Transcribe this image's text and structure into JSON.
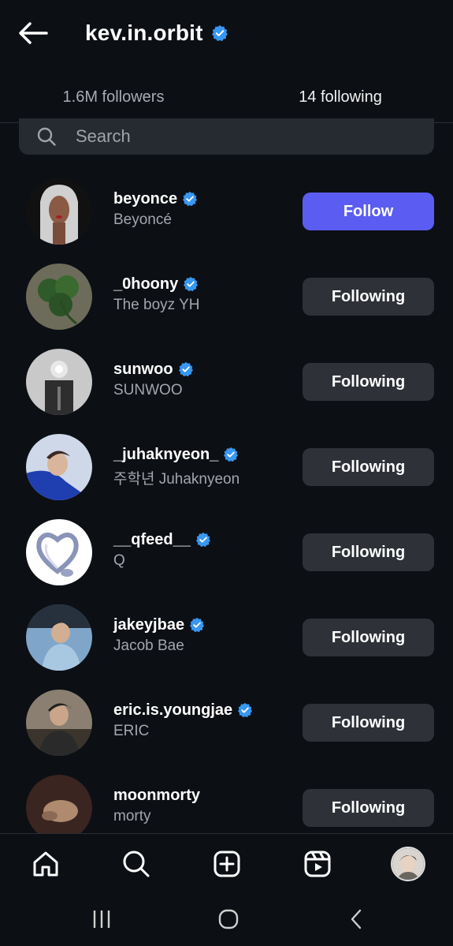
{
  "header": {
    "title": "kev.in.orbit"
  },
  "tabs": {
    "followers_label": "1.6M followers",
    "following_label": "14 following"
  },
  "search": {
    "placeholder": "Search"
  },
  "accounts": [
    {
      "username": "beyonce",
      "fullname": "Beyoncé",
      "button": "Follow"
    },
    {
      "username": "_0hoony",
      "fullname": "The boyz YH",
      "button": "Following"
    },
    {
      "username": "sunwoo",
      "fullname": "SUNWOO",
      "button": "Following"
    },
    {
      "username": "_juhaknyeon_",
      "fullname": "주학년 Juhaknyeon",
      "button": "Following"
    },
    {
      "username": "__qfeed__",
      "fullname": "Q",
      "button": "Following"
    },
    {
      "username": "jakeyjbae",
      "fullname": "Jacob Bae",
      "button": "Following"
    },
    {
      "username": "eric.is.youngjae",
      "fullname": "ERIC",
      "button": "Following"
    },
    {
      "username": "moonmorty",
      "fullname": "morty",
      "button": "Following"
    }
  ],
  "colors": {
    "accent": "#5b5cf2",
    "verified": "#3897f0",
    "background": "#0c0f14",
    "button_secondary": "#2e3137"
  },
  "bottom_nav": [
    "home-icon",
    "search-icon",
    "create-icon",
    "reels-icon",
    "profile-avatar"
  ],
  "system_nav": [
    "recents-icon",
    "home-circle-icon",
    "back-chevron-icon"
  ]
}
